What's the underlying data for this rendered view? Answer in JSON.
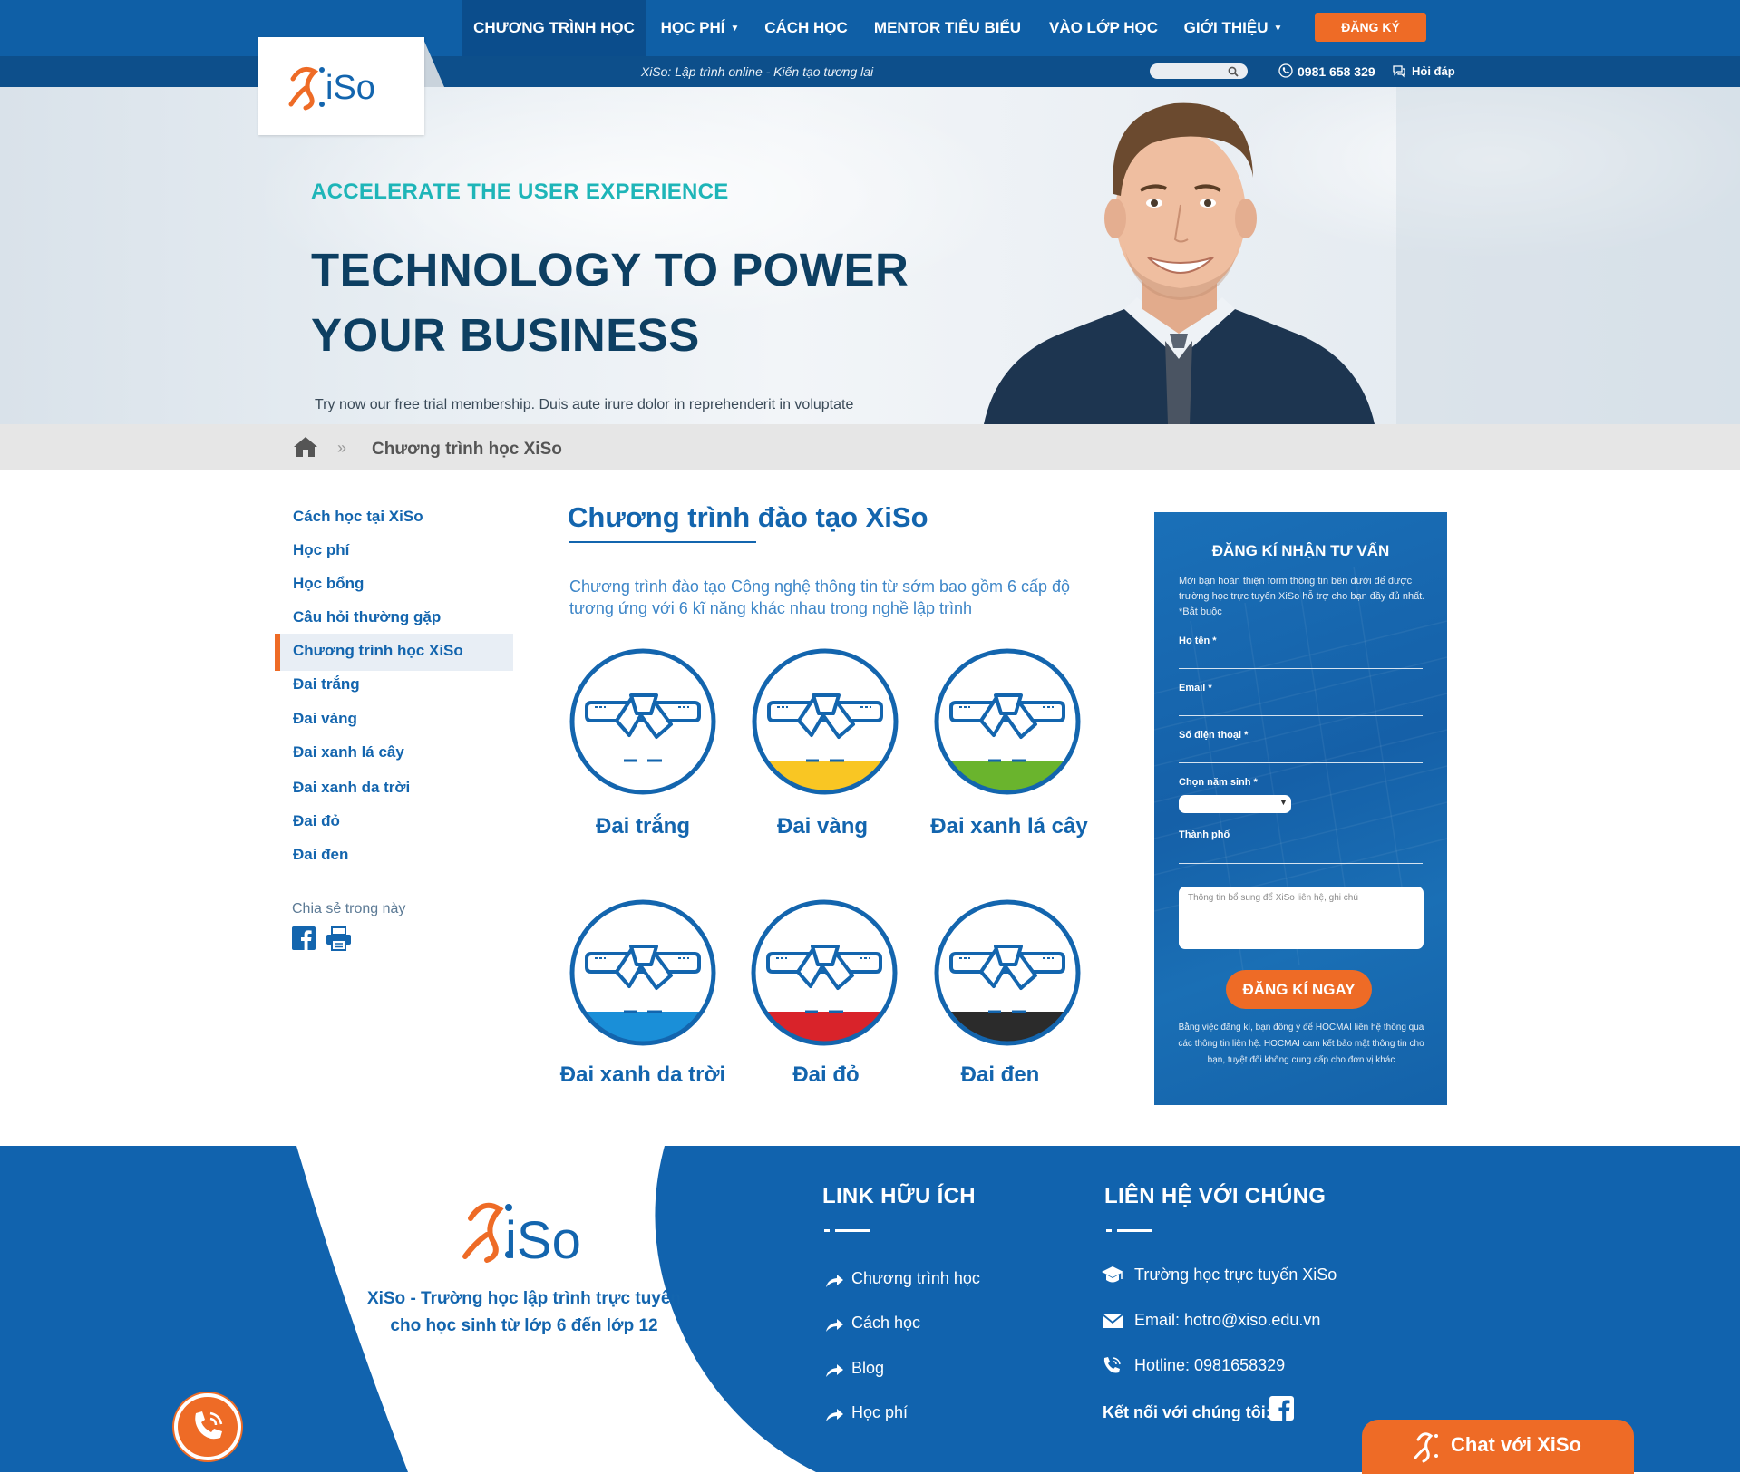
{
  "nav": {
    "items": [
      {
        "label": "CHƯƠNG TRÌNH HỌC",
        "dropdown": false,
        "active": true
      },
      {
        "label": "HỌC PHÍ",
        "dropdown": true,
        "active": false
      },
      {
        "label": "CÁCH HỌC",
        "dropdown": false,
        "active": false
      },
      {
        "label": "MENTOR TIÊU BIỂU",
        "dropdown": false,
        "active": false
      },
      {
        "label": "VÀO LỚP HỌC",
        "dropdown": false,
        "active": false
      },
      {
        "label": "GIỚI THIỆU",
        "dropdown": true,
        "active": false
      }
    ],
    "register_label": "ĐĂNG KÝ"
  },
  "subbar": {
    "tagline": "XiSo: Lập trình online - Kiến tạo tương lai",
    "search_placeholder": "",
    "phone": "0981 658 329",
    "faq": "Hỏi đáp"
  },
  "logo": {
    "text_x": "X",
    "text_rest": "iSo"
  },
  "hero": {
    "subtitle": "ACCELERATE THE USER EXPERIENCE",
    "title_line1": "TECHNOLOGY TO POWER",
    "title_line2": "YOUR BUSINESS",
    "description": "Try now our free trial membership. Duis aute irure dolor in reprehenderit in voluptate"
  },
  "breadcrumb": {
    "separator": "»",
    "current": "Chương trình học XiSo"
  },
  "sidebar": {
    "items": [
      {
        "label": "Cách học tại XiSo",
        "active": false
      },
      {
        "label": "Học phí",
        "active": false
      },
      {
        "label": "Học bổng",
        "active": false
      },
      {
        "label": "Câu hỏi thường gặp",
        "active": false
      },
      {
        "label": "Chương trình học XiSo",
        "active": true
      },
      {
        "label": "Đai trắng",
        "active": false
      },
      {
        "label": "Đai vàng",
        "active": false
      },
      {
        "label": "Đai xanh lá cây",
        "active": false
      },
      {
        "label": "Đai xanh da trời",
        "active": false
      },
      {
        "label": "Đai đỏ",
        "active": false
      },
      {
        "label": "Đai đen",
        "active": false
      }
    ],
    "share_label": "Chia sẻ trong này"
  },
  "main": {
    "title": "Chương trình đào tạo XiSo",
    "description": "Chương trình đào tạo Công nghệ thông tin từ sớm bao gồm 6 cấp độ tương ứng với 6 kĩ năng khác nhau trong nghề lập trình",
    "belts": [
      {
        "label": "Đai trắng",
        "color": "#ffffff"
      },
      {
        "label": "Đai vàng",
        "color": "#f9c623"
      },
      {
        "label": "Đai xanh lá cây",
        "color": "#6ab42d"
      },
      {
        "label": "Đai xanh da trời",
        "color": "#1a8fd8"
      },
      {
        "label": "Đai đỏ",
        "color": "#d9232a"
      },
      {
        "label": "Đai đen",
        "color": "#2b2b2b"
      }
    ]
  },
  "form": {
    "title": "ĐĂNG KÍ NHẬN TƯ VẤN",
    "description": "Mời bạn hoàn thiện form thông tin bên dưới để được trường học trực tuyến XiSo hỗ trợ cho bạn đầy đủ nhất.",
    "required_note": "*Bắt buộc",
    "labels": {
      "name": "Họ tên *",
      "email": "Email *",
      "phone": "Số điện thoại *",
      "birth_year": "Chọn năm sinh *",
      "city": "Thành phố"
    },
    "notes_placeholder": "Thông tin bổ sung để XiSo liên hệ, ghi chú",
    "submit_label": "ĐĂNG KÍ NGAY",
    "privacy_note": "Bằng việc đăng kí, bạn đồng ý để HOCMAI liên hệ thông qua các thông tin liên hệ. HOCMAI cam kết bảo mật thông tin cho bạn, tuyệt đối không cung cấp cho đơn vị khác"
  },
  "footer": {
    "tagline_line1": "XiSo - Trường học lập trình trực tuyến",
    "tagline_line2": "cho học sinh từ lớp 6 đến lớp 12",
    "links_heading": "LINK HỮU ÍCH",
    "links": [
      "Chương trình học",
      "Cách học",
      "Blog",
      "Học phí"
    ],
    "contact_heading": "LIÊN HỆ VỚI CHÚNG",
    "contacts": [
      {
        "icon": "graduation-cap-icon",
        "text": "Trường học trực tuyến XiSo"
      },
      {
        "icon": "envelope-icon",
        "text": "Email: hotro@xiso.edu.vn"
      },
      {
        "icon": "phone-icon",
        "text": "Hotline: 0981658329"
      }
    ],
    "connect_label": "Kết nối với chúng tôi:"
  },
  "chat": {
    "label": "Chat với XiSo"
  },
  "colors": {
    "primary": "#1163ae",
    "nav_bg": "#0f5fa6",
    "accent": "#ee6b26",
    "teal": "#1eb5b8",
    "hero_title": "#0d3f62"
  }
}
